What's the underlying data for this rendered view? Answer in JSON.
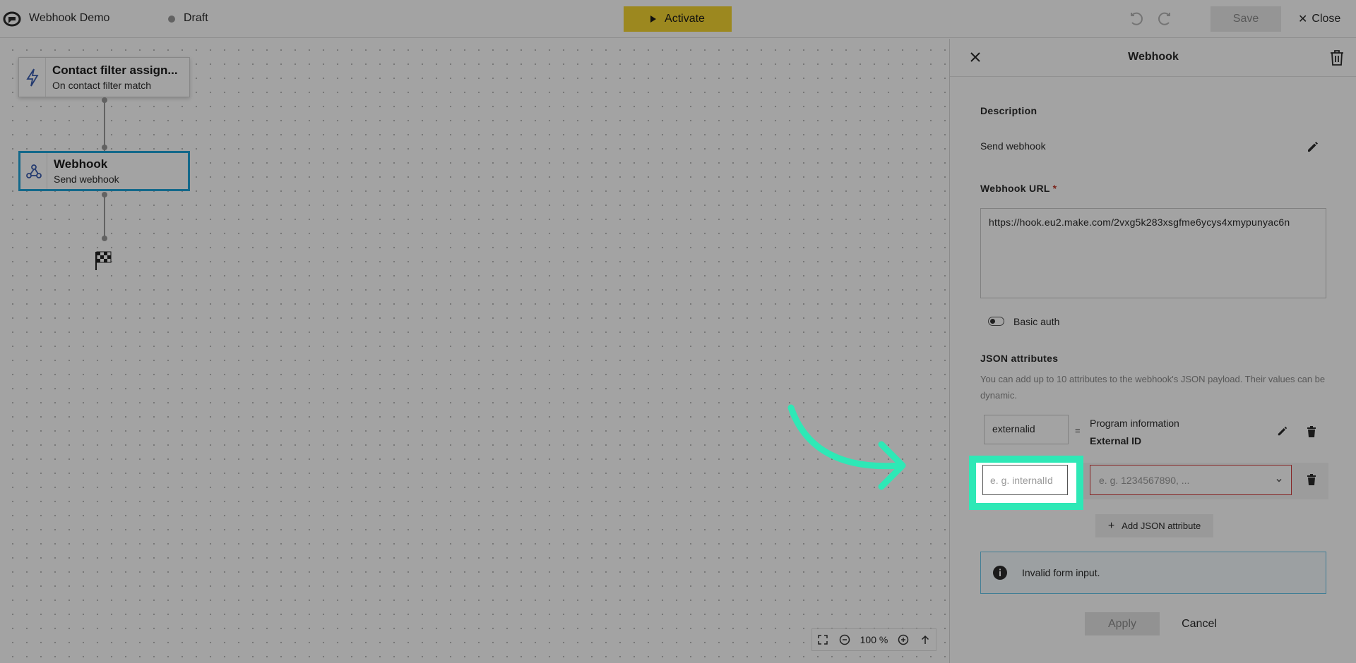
{
  "topbar": {
    "app_title": "Webhook Demo",
    "status": "Draft",
    "activate_label": "Activate",
    "save_label": "Save",
    "close_label": "Close",
    "accent": "#f5d531"
  },
  "canvas": {
    "nodes": [
      {
        "title": "Contact filter assign...",
        "subtitle": "On contact filter match",
        "icon": "lightning-icon"
      },
      {
        "title": "Webhook",
        "subtitle": "Send webhook",
        "icon": "webhook-icon"
      }
    ],
    "end_icon": "checkered-flag-icon",
    "zoom_level": "100 %"
  },
  "panel": {
    "title": "Webhook",
    "description_label": "Description",
    "description_value": "Send webhook",
    "url_label": "Webhook URL",
    "url_required": "*",
    "url_value": "https://hook.eu2.make.com/2vxg5k283xsgfme6ycys4xmypunyac6n",
    "basic_auth_label": "Basic auth",
    "json_label": "JSON attributes",
    "json_help": "You can add up to 10 attributes to the webhook's JSON payload. Their values can be dynamic.",
    "attributes": [
      {
        "key": "externalid",
        "separator": "=",
        "value_line1": "Program information",
        "value_line2": "External ID"
      }
    ],
    "new_key_placeholder": "e. g. internalId",
    "new_value_placeholder": "e. g. 1234567890, ...",
    "add_attr_label": "Add JSON attribute",
    "alert_text": "Invalid form input.",
    "apply_label": "Apply",
    "cancel_label": "Cancel"
  },
  "colors": {
    "highlight": "#2ee8b6",
    "selected_node": "#1ea3d8",
    "error": "#d23c3c"
  }
}
